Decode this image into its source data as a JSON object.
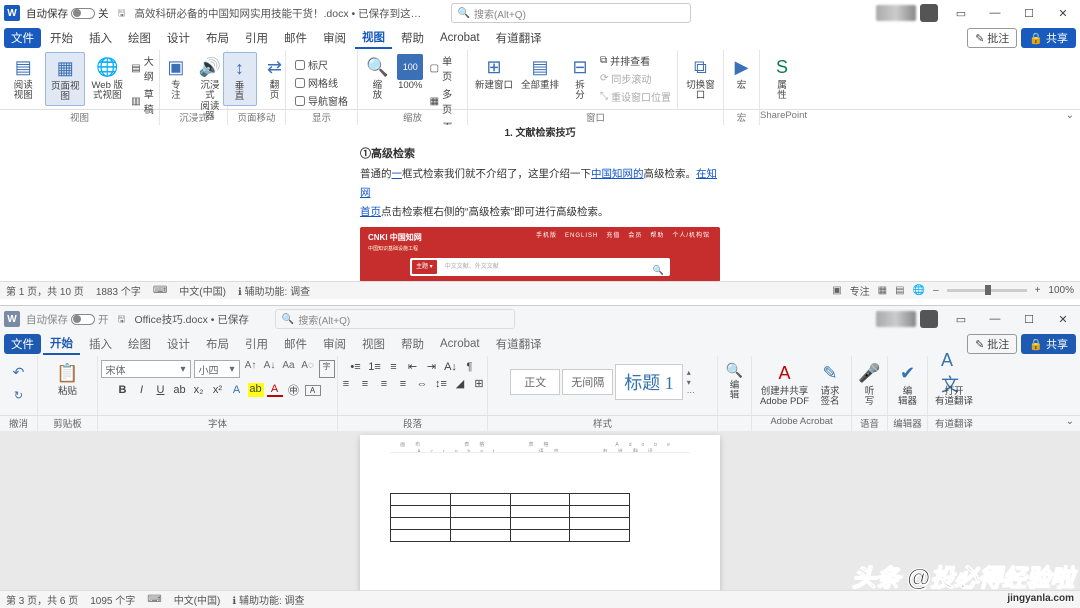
{
  "win1": {
    "autosave_label": "自动保存",
    "autosave_state": "关",
    "title": "高效科研必备的中国知网实用技能干货！.docx • 已保存到这台电脑",
    "search_placeholder": "搜索(Alt+Q)",
    "menus": {
      "file": "文件",
      "home": "开始",
      "insert": "插入",
      "draw": "绘图",
      "design": "设计",
      "layout": "布局",
      "ref": "引用",
      "mail": "邮件",
      "review": "审阅",
      "view": "视图",
      "help": "帮助",
      "acrobat": "Acrobat",
      "youdao": "有道翻译"
    },
    "btn_comment": "批注",
    "btn_share": "共享",
    "ribbon": {
      "yuedu": "阅读\n视图",
      "yemian": "页面视图",
      "web": "Web 版式视图",
      "dagang": "大纲",
      "caogao": "草稿",
      "zhuanzhu": "专\n注",
      "chenjin": "沉浸式\n阅读器",
      "chuizhi": "垂\n直",
      "fanye": "翻\n页",
      "biaochi": "标尺",
      "wangge": "网格线",
      "daohang": "导航窗格",
      "suofang": "缩\n放",
      "bai": "100%",
      "danye": "单页",
      "duoye": "多页",
      "yekuan": "页宽",
      "xinjian": "新建窗口",
      "quanbu": "全部重排",
      "chaifen": "拆\n分",
      "bingpai": "并排查看",
      "tongbu": "同步滚动",
      "chongshe": "重设窗口位置",
      "qiehuan": "切换窗\n口",
      "hong": "宏",
      "shuxing": "属\n性",
      "g_view": "视图",
      "g_imm": "沉浸式",
      "g_move": "页面移动",
      "g_show": "显示",
      "g_zoom": "缩放",
      "g_win": "窗口",
      "g_macro": "宏",
      "g_sp": "SharePoint"
    },
    "doc": {
      "heading_top": "1. 文献检索技巧",
      "sub": "①高级检索",
      "p1a": "普通的",
      "p1link1": "一",
      "p1b": "框式检索我们就不介绍了，这里介绍一下",
      "p1link2": "中国知网的",
      "p1c": "高级检索。",
      "p1link3": "在知网",
      "p2link": "首页",
      "p2": "点击检索框右侧的“高级检索”即可进行高级检索。",
      "banner_logo": "CNKI 中国知网",
      "banner_sel": "主题 ▾",
      "banner_ph": "中文文献、外文文献"
    },
    "status": {
      "page": "第 1 页，共 10 页",
      "words": "1883 个字",
      "lang": "中文(中国)",
      "access": "辅助功能: 调查",
      "zhuanzhu": "专注",
      "zoom": "100%"
    }
  },
  "win2": {
    "autosave_label": "自动保存",
    "autosave_state": "开",
    "title": "Office技巧.docx • 已保存",
    "search_placeholder": "搜索(Alt+Q)",
    "menus": {
      "file": "文件",
      "home": "开始",
      "insert": "插入",
      "draw": "绘图",
      "design": "设计",
      "layout": "布局",
      "ref": "引用",
      "mail": "邮件",
      "review": "审阅",
      "view": "视图",
      "help": "帮助",
      "acrobat": "Acrobat",
      "youdao": "有道翻译"
    },
    "btn_comment": "批注",
    "btn_share": "共享",
    "ribbon": {
      "undo": "撤消",
      "paste": "粘贴",
      "clipboard": "剪贴板",
      "font_name": "宋体",
      "font_size": "小四",
      "styles": {
        "normal": "正文",
        "nospace": "无间隔",
        "h1": "标题 1"
      },
      "g_font": "字体",
      "g_para": "段落",
      "g_style": "样式",
      "bianji": "编\n辑",
      "adobe": "创建并共享\nAdobe PDF",
      "qianming": "请求\n签名",
      "tingxie": "听\n写",
      "bianjiqi": "编\n辑器",
      "dakai": "打开\n有道翻译",
      "g_adobe": "Adobe Acrobat",
      "g_voice": "语音",
      "g_editor": "编辑器",
      "g_youdao": "有道翻译"
    },
    "status": {
      "page": "第 3 页，共 6 页",
      "words": "1095 个字",
      "lang": "中文(中国)",
      "access": "辅助功能: 调查"
    }
  },
  "watermark_a": "头条 @投必得",
  "watermark_b": "经验",
  "watermark_c": "啦",
  "watermark_suffix": "jingyanla.com"
}
